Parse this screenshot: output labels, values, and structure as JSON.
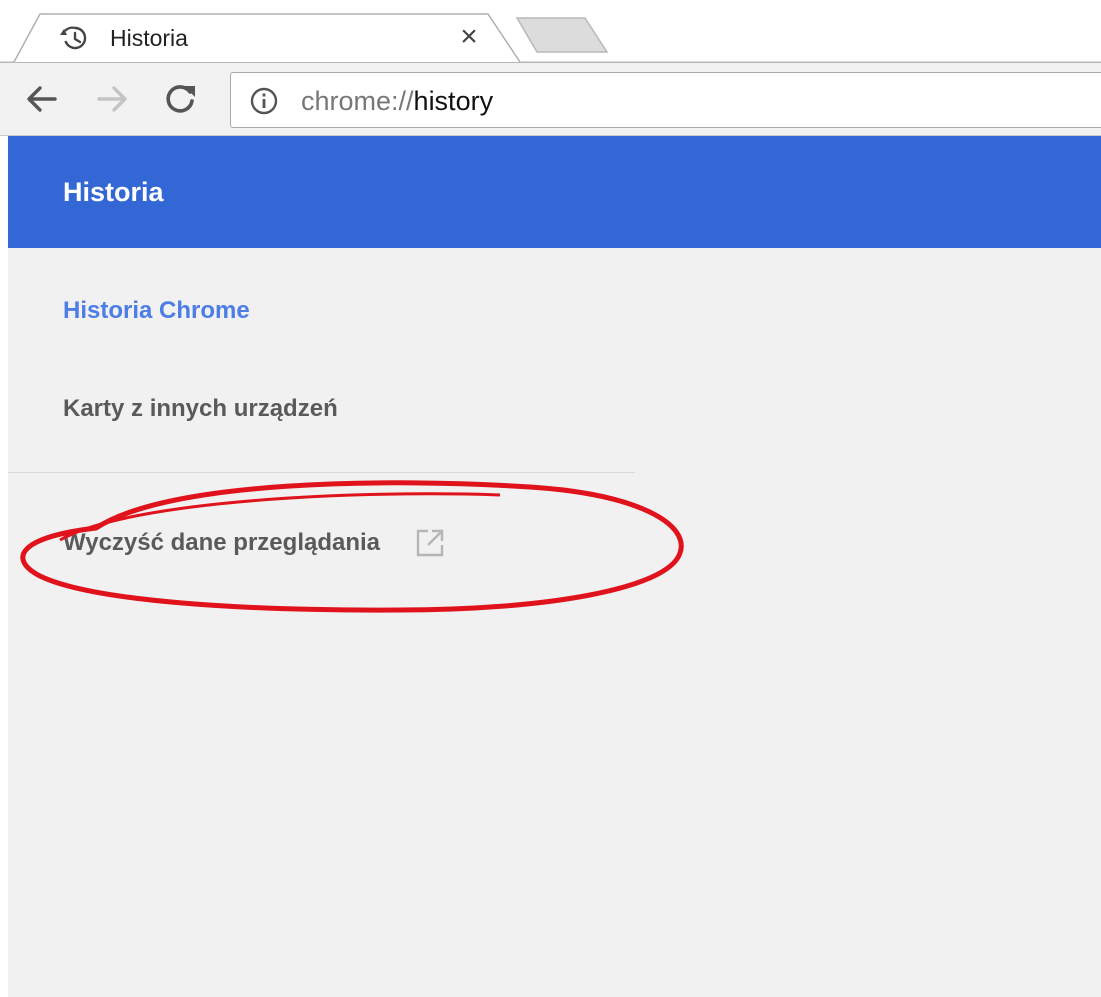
{
  "browser": {
    "tab": {
      "title": "Historia",
      "icon": "history-icon",
      "close_glyph": "×"
    },
    "toolbar": {
      "back_icon": "arrow-left-icon",
      "forward_icon": "arrow-right-icon",
      "reload_icon": "reload-icon",
      "url_scheme": "chrome://",
      "url_host": "history",
      "info_icon": "info-icon"
    }
  },
  "page": {
    "header_title": "Historia",
    "sidebar": {
      "items": [
        {
          "label": "Historia Chrome",
          "selected": true
        },
        {
          "label": "Karty z innych urządzeń",
          "selected": false
        },
        {
          "label": "Wyczyść dane przeglądania",
          "icon": "open-in-new-icon"
        }
      ]
    }
  },
  "colors": {
    "header_blue": "#3367d6",
    "selected_item": "#4d7de6",
    "annotation_red": "#e0131c",
    "page_background": "#f1f1f1"
  },
  "annotation": {
    "shape": "ellipse",
    "target": "Wyczyść dane przeglądania"
  }
}
